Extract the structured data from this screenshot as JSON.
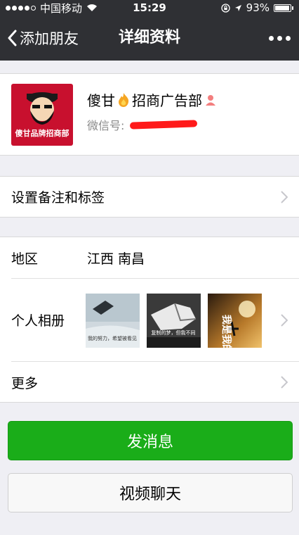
{
  "status_bar": {
    "carrier": "中国移动",
    "time": "15:29",
    "battery": "93%"
  },
  "navbar": {
    "back_label": "添加朋友",
    "title": "详细资料"
  },
  "profile": {
    "name_part1": "傻甘",
    "name_part2": "招商广告部",
    "wechat_id_label": "微信号:",
    "avatar_text": "傻甘品牌招商部"
  },
  "rows": {
    "remark_label": "设置备注和标签",
    "region_label": "地区",
    "region_value": "江西 南昌",
    "album_label": "个人相册",
    "more_label": "更多"
  },
  "album": {
    "photo1_caption": "我的努力，希望被看见",
    "photo2_caption": "复制的梦，但我不同",
    "photo3_caption": "我是我的梦"
  },
  "buttons": {
    "send_message": "发消息",
    "video_call": "视频聊天"
  }
}
